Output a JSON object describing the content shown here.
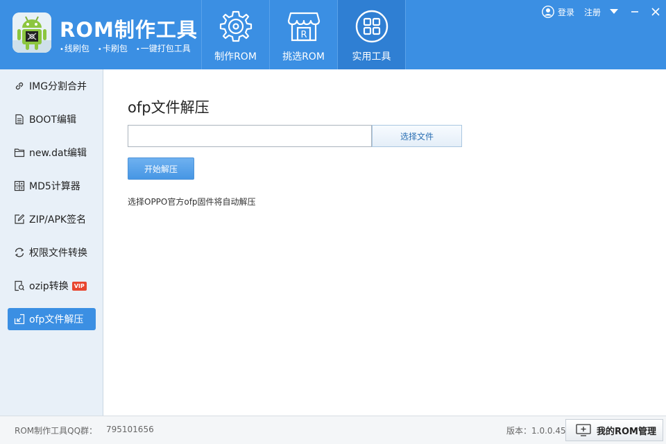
{
  "app": {
    "title": "ROM制作工具",
    "subtitles": [
      "线刷包",
      "卡刷包",
      "一键打包工具"
    ]
  },
  "nav": [
    {
      "label": "制作ROM",
      "icon": "gear-disc-icon",
      "active": false
    },
    {
      "label": "挑选ROM",
      "icon": "store-icon",
      "active": false
    },
    {
      "label": "实用工具",
      "icon": "grid-tools-icon",
      "active": true
    }
  ],
  "top_right": {
    "login": "登录",
    "register": "注册"
  },
  "sidebar": {
    "items": [
      {
        "label": "IMG分割合并",
        "icon": "link-icon"
      },
      {
        "label": "BOOT编辑",
        "icon": "document-icon"
      },
      {
        "label": "new.dat编辑",
        "icon": "folder-icon"
      },
      {
        "label": "MD5计算器",
        "icon": "calculator-icon"
      },
      {
        "label": "ZIP/APK签名",
        "icon": "sign-edit-icon"
      },
      {
        "label": "权限文件转换",
        "icon": "convert-icon"
      },
      {
        "label": "ozip转换",
        "icon": "file-search-icon",
        "badge": "VIP"
      },
      {
        "label": "ofp文件解压",
        "icon": "extract-icon",
        "active": true
      }
    ]
  },
  "main": {
    "title": "ofp文件解压",
    "file_input_value": "",
    "choose_button": "选择文件",
    "start_button": "开始解压",
    "hint": "选择OPPO官方ofp固件将自动解压"
  },
  "footer": {
    "qq_label": "ROM制作工具QQ群：",
    "qq_number": "795101656",
    "version": "版本：1.0.0.45",
    "rom_manage": "我的ROM管理"
  },
  "colors": {
    "header_blue": "#3b8fe3",
    "active_nav": "#2f7fd3",
    "sidebar_bg": "#e8f0f8",
    "vip_red": "#e8462f"
  }
}
